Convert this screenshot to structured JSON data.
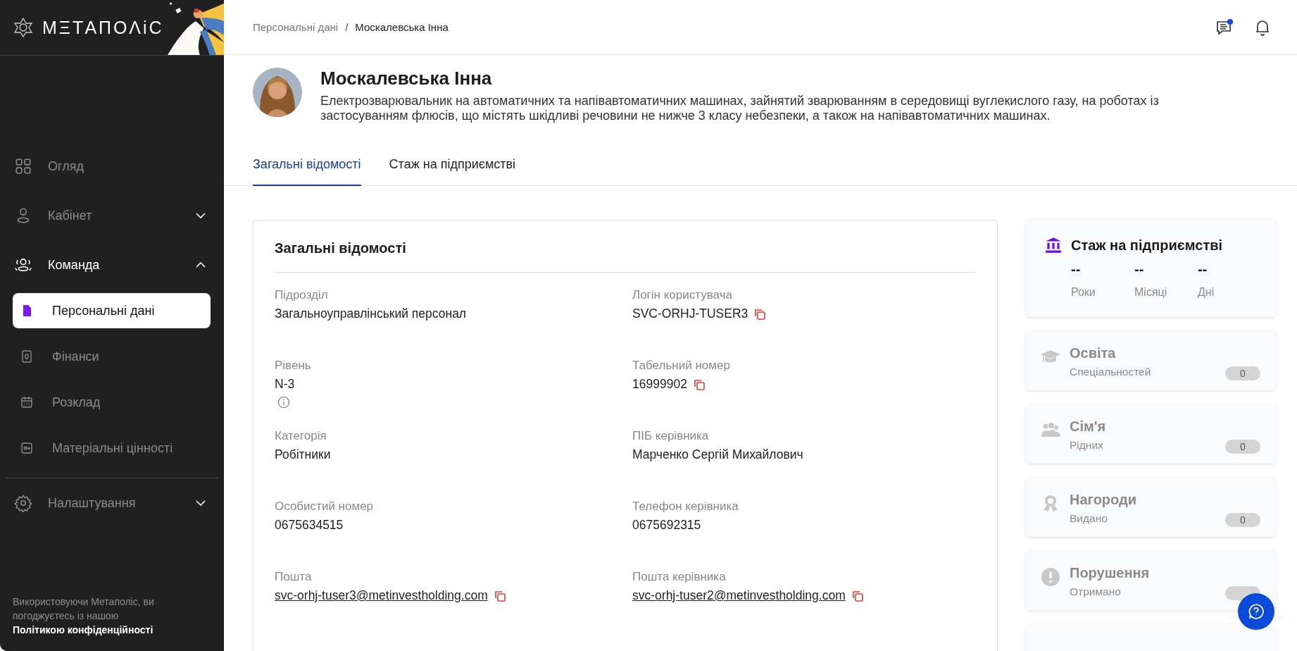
{
  "sidebar": {
    "logo": "МΞТАПОΛіС",
    "items": [
      {
        "label": "Огляд",
        "kind": "link",
        "selected": false
      },
      {
        "label": "Кабінет",
        "kind": "group",
        "expanded": false,
        "selected": false
      },
      {
        "label": "Команда",
        "kind": "group",
        "expanded": true,
        "selected": true,
        "children": [
          {
            "label": "Персональні дані",
            "selected": true
          },
          {
            "label": "Фінанси",
            "selected": false
          },
          {
            "label": "Розклад",
            "selected": false
          },
          {
            "label": "Матеріальні цінності",
            "selected": false
          }
        ]
      },
      {
        "label": "Налаштування",
        "kind": "group",
        "expanded": false,
        "selected": false
      }
    ],
    "footer": {
      "text": "Використовуючи Метаполіс, ви погоджуєтесь із нашою ",
      "link": "Політикою конфіденційності"
    }
  },
  "breadcrumb_separator": "/",
  "breadcrumbs": [
    {
      "label": "Персональні дані",
      "current": false
    },
    {
      "label": "Москалевська Інна",
      "current": true
    }
  ],
  "header": {
    "messages_unread": true
  },
  "profile": {
    "name": "Москалевська Інна",
    "position": "Електрозварювальник на автоматичних та напівавтоматичних машинах, зайнятий зварюванням в середовищі вуглекислого газу, на роботах із застосуванням флюсів, що містять шкідливі речовини не нижче 3 класу небезпеки, а також на напівавтоматичних машинах."
  },
  "tabs": [
    {
      "label": "Загальні відомості",
      "selected": true
    },
    {
      "label": "Стаж на підприємстві",
      "selected": false
    }
  ],
  "general": {
    "title": "Загальні відомості",
    "fields": [
      {
        "label": "Підрозділ",
        "value": "Загальноуправлінський персонал",
        "kind": "text"
      },
      {
        "label": "Логін користувача",
        "value": "SVC-ORHJ-TUSER3",
        "kind": "copy"
      },
      {
        "label": "Рівень",
        "value": "N-3",
        "kind": "text",
        "info": true
      },
      {
        "label": "Табельний номер",
        "value": "16999902",
        "kind": "copy"
      },
      {
        "label": "Категорія",
        "value": "Робітники",
        "kind": "text"
      },
      {
        "label": "ПІБ керівника",
        "value": "Марченко Сергій Михайлович",
        "kind": "text"
      },
      {
        "label": "Особистий номер",
        "value": "0675634515",
        "kind": "text"
      },
      {
        "label": "Телефон керівника",
        "value": "0675692315",
        "kind": "text"
      },
      {
        "label": "Пошта",
        "value": "svc-orhj-tuser3@metinvestholding.com",
        "kind": "link"
      },
      {
        "label": "Пошта керівника",
        "value": "svc-orhj-tuser2@metinvestholding.com",
        "kind": "link"
      }
    ]
  },
  "tenure": {
    "title": "Стаж на підприємстві",
    "stats": [
      {
        "value": "--",
        "label": "Роки"
      },
      {
        "value": "--",
        "label": "Місяці"
      },
      {
        "value": "--",
        "label": "Дні"
      }
    ]
  },
  "summary_cards": [
    {
      "title": "Освіта",
      "subtitle": "Спеціальностей",
      "count": "0"
    },
    {
      "title": "Сім'я",
      "subtitle": "Рідних",
      "count": "0"
    },
    {
      "title": "Нагороди",
      "subtitle": "Видано",
      "count": "0"
    },
    {
      "title": "Порушення",
      "subtitle": "Отримано"
    }
  ]
}
